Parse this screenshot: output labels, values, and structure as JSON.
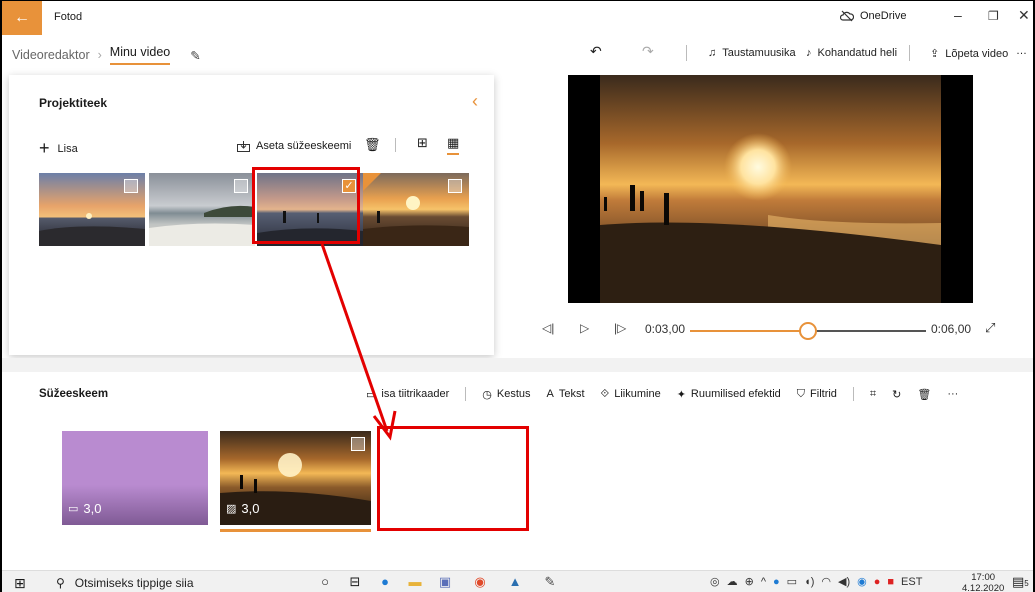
{
  "window": {
    "app_title": "Fotod",
    "onedrive_label": "OneDrive"
  },
  "header": {
    "breadcrumb_root": "Videoredaktor",
    "breadcrumb_current": "Minu video",
    "background_music": "Taustamuusika",
    "custom_audio": "Kohandatud heli",
    "finish_video": "Lõpeta video"
  },
  "library": {
    "title": "Projektiteek",
    "add_label": "Lisa",
    "place_label": "Aseta süžeeskeemi",
    "thumbnails": [
      {
        "checked": false
      },
      {
        "checked": false
      },
      {
        "checked": true
      },
      {
        "checked": false
      }
    ]
  },
  "playback": {
    "current_time": "0:03,00",
    "total_time": "0:06,00",
    "progress": 0.5
  },
  "storyboard": {
    "title": "Süžeeskeem",
    "tools": {
      "title_card": "isa tiitrikaader",
      "duration": "Kestus",
      "text": "Tekst",
      "motion": "Liikumine",
      "effects_3d": "Ruumilised efektid",
      "filters": "Filtrid"
    },
    "cards": [
      {
        "duration": "3,0",
        "color": "#b98bd0"
      },
      {
        "duration": "3,0"
      }
    ]
  },
  "taskbar": {
    "search_placeholder": "Otsimiseks tippige siia",
    "language": "EST",
    "time": "17:00",
    "date": "4.12.2020",
    "notification_count": "5"
  },
  "colors": {
    "accent": "#e8923a",
    "highlight_red": "#e30000"
  }
}
